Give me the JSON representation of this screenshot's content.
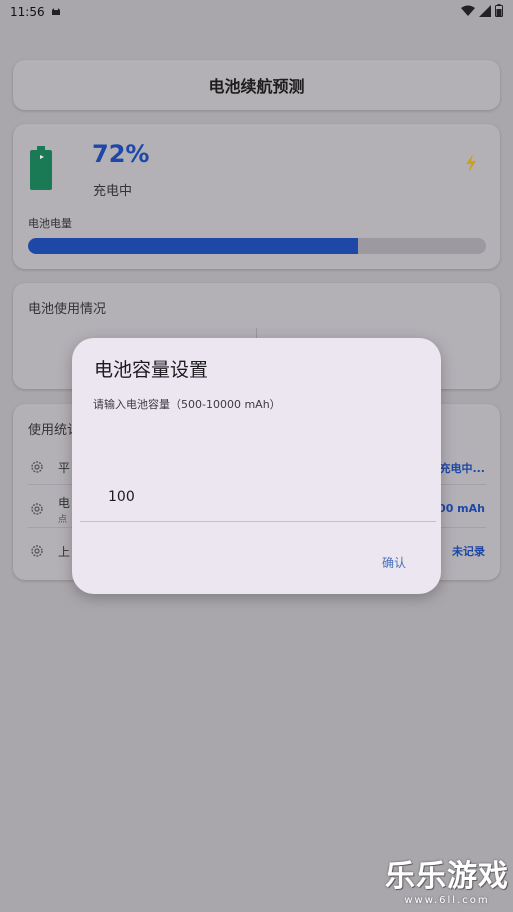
{
  "status_bar": {
    "time": "11:56"
  },
  "header": {
    "title": "电池续航预测"
  },
  "battery": {
    "percent_text": "72%",
    "level": 0.72,
    "state": "充电中",
    "level_label": "电池电量",
    "colors": {
      "accent": "#1d48a7",
      "battery": "#1a7a55",
      "bolt": "#c9a21a"
    }
  },
  "usage": {
    "title": "电池使用情况"
  },
  "stats": {
    "title": "使用统计",
    "rows": [
      {
        "label": "平",
        "value": "充电中..."
      },
      {
        "label": "电",
        "sublabel": "点",
        "value": "100 mAh"
      },
      {
        "label": "上",
        "value": "未记录"
      }
    ]
  },
  "dialog": {
    "title": "电池容量设置",
    "hint": "请输入电池容量（500-10000 mAh）",
    "input_value": "100",
    "confirm_label": "确认"
  },
  "watermark": {
    "text": "乐乐游戏",
    "url": "www.6ll.com"
  }
}
